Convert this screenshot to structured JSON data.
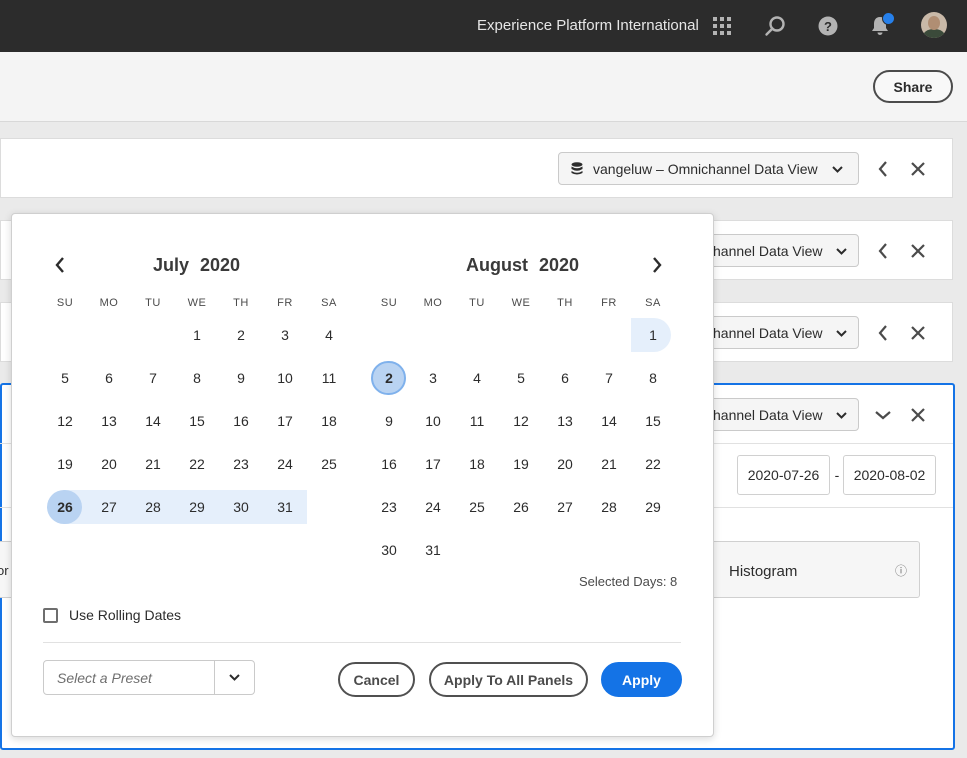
{
  "header": {
    "org_name": "Experience Platform International",
    "icons": [
      "apps-grid-icon",
      "search-icon",
      "help-icon",
      "bell-icon",
      "avatar"
    ]
  },
  "toolbar": {
    "share_label": "Share"
  },
  "panels": {
    "data_view_full": "vangeluw – Omnichannel Data View",
    "data_view_partial": "hannel Data View"
  },
  "date_range": {
    "start": "2020-07-26",
    "separator": "-",
    "end": "2020-08-02"
  },
  "visualization": {
    "label": "Histogram",
    "info_glyph": "ⓘ",
    "left_partial": "or"
  },
  "calendar": {
    "left_month": "July 2020",
    "right_month": "August 2020",
    "weekdays": [
      "SU",
      "MO",
      "TU",
      "WE",
      "TH",
      "FR",
      "SA"
    ],
    "july_days": [
      "1",
      "2",
      "3",
      "4",
      "5",
      "6",
      "7",
      "8",
      "9",
      "10",
      "11",
      "12",
      "13",
      "14",
      "15",
      "16",
      "17",
      "18",
      "19",
      "20",
      "21",
      "22",
      "23",
      "24",
      "25",
      "26",
      "27",
      "28",
      "29",
      "30",
      "31"
    ],
    "august_days": [
      "1",
      "2",
      "3",
      "4",
      "5",
      "6",
      "7",
      "8",
      "9",
      "10",
      "11",
      "12",
      "13",
      "14",
      "15",
      "16",
      "17",
      "18",
      "19",
      "20",
      "21",
      "22",
      "23",
      "24",
      "25",
      "26",
      "27",
      "28",
      "29",
      "30",
      "31"
    ],
    "july_first_weekday": 3,
    "august_first_weekday": 6,
    "selected_start": "2020-07-26",
    "selected_end": "2020-08-01",
    "today": "2020-08-02",
    "selected_days_label": "Selected Days: 8"
  },
  "options": {
    "rolling_label": "Use Rolling Dates",
    "rolling_checked": false
  },
  "preset": {
    "placeholder": "Select a Preset"
  },
  "actions": {
    "cancel": "Cancel",
    "apply_all": "Apply To All Panels",
    "apply": "Apply"
  },
  "colors": {
    "accent": "#1473e6",
    "range_fill": "#e5effb",
    "circle_fill": "#b9d3f2",
    "topbar": "#2c2c2c"
  }
}
